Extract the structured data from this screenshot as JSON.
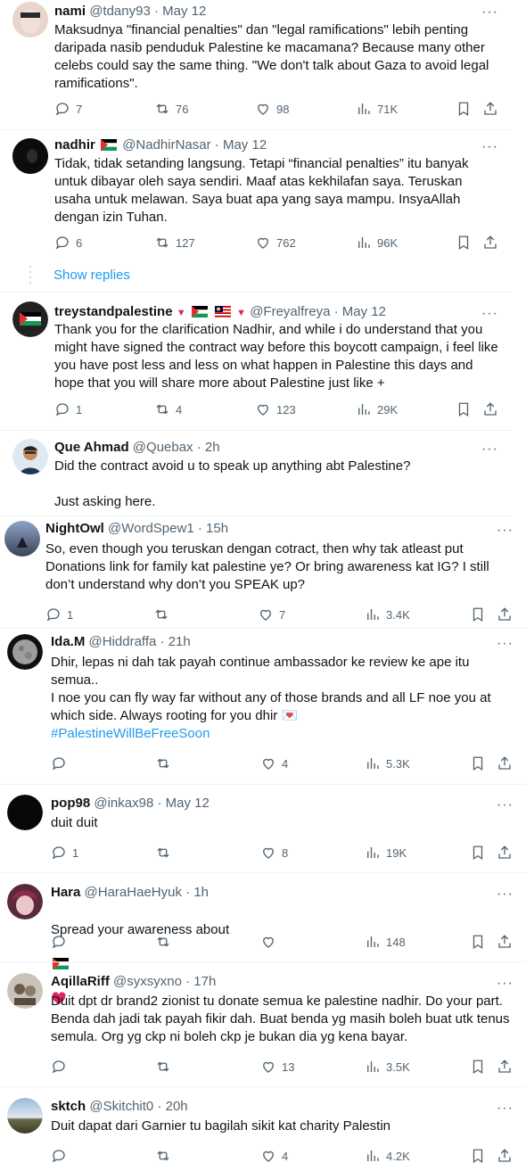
{
  "tweets": [
    {
      "name": "nami",
      "handle": "@tdany93",
      "date": "May 12",
      "text": "Maksudnya \"financial penalties\" dan \"legal ramifications\" lebih penting daripada nasib penduduk Palestine ke macamana? Because many other celebs could say the same thing. \"We don't talk about Gaza to avoid legal ramifications\".",
      "replies": "7",
      "reposts": "76",
      "likes": "98",
      "views": "71K"
    },
    {
      "name": "nadhir",
      "handle": "@NadhirNasar",
      "date": "May 12",
      "text": "Tidak, tidak setanding langsung. Tetapi “financial penalties” itu banyak untuk dibayar oleh saya sendiri. Maaf atas kekhilafan saya. Teruskan usaha untuk melawan. Saya buat apa yang saya mampu. InsyaAllah dengan izin Tuhan.",
      "replies": "6",
      "reposts": "127",
      "likes": "762",
      "views": "96K"
    },
    {
      "name": "treystandpalestine",
      "handle": "@Freyalfreya",
      "date": "May 12",
      "text": "Thank you for the clarification Nadhir, and while i do understand that you might have signed the contract way before this boycott campaign, i feel like you have post less and less on what happen in Palestine this days and hope that you will share more about Palestine just like +",
      "replies": "1",
      "reposts": "4",
      "likes": "123",
      "views": "29K"
    },
    {
      "name": "Que Ahmad",
      "handle": "@Quebax",
      "date": "2h",
      "text": "Did the contract avoid u to speak up anything abt Palestine?\n\nJust asking here."
    },
    {
      "name": "NightOwl",
      "handle": "@WordSpew1",
      "date": "15h",
      "text": "So, even though you teruskan dengan cotract, then why tak atleast put Donations link for family kat palestine ye? Or bring awareness kat IG? I still don’t understand why don’t you SPEAK up?",
      "replies": "1",
      "reposts": "",
      "likes": "7",
      "views": "3.4K"
    },
    {
      "name": "Ida.M",
      "handle": "@Hiddraffa",
      "date": "21h",
      "text": "Dhir, lepas ni dah tak payah continue ambassador ke review ke ape itu semua..\nI noe you can fly way far without any of those brands and all LF noe you at which side. Always rooting for you dhir 💌",
      "hashtag": "#PalestineWillBeFreeSoon",
      "replies": "",
      "reposts": "",
      "likes": "4",
      "views": "5.3K"
    },
    {
      "name": "pop98",
      "handle": "@inkax98",
      "date": "May 12",
      "text": "duit duit",
      "replies": "1",
      "reposts": "",
      "likes": "8",
      "views": "19K"
    },
    {
      "name": "Hara",
      "handle": "@HaraHaeHyuk",
      "date": "1h",
      "text": "Spread your awareness about",
      "replies": "",
      "reposts": "",
      "likes": "",
      "views": "148"
    },
    {
      "name": "AqillaRiff",
      "handle": "@syxsyxno",
      "date": "17h",
      "text": "Duit dpt dr brand2 zionist tu donate semua ke palestine nadhir. Do your part. Benda dah jadi tak payah fikir dah. Buat benda yg masih boleh buat utk tenus semula. Org yg ckp ni boleh ckp je bukan dia yg kena bayar.",
      "replies": "",
      "reposts": "",
      "likes": "13",
      "views": "3.5K"
    },
    {
      "name": "sktch",
      "handle": "@Skitchit0",
      "date": "20h",
      "text": "Duit dapat dari Garnier tu bagilah sikit kat charity Palestin",
      "replies": "",
      "reposts": "",
      "likes": "4",
      "views": "4.2K"
    }
  ],
  "show_replies": "Show replies",
  "more_label": "···",
  "colors": {
    "text": "#0f1419",
    "muted": "#536471",
    "link": "#1d9bf0",
    "border": "#eff3f4",
    "heart": "#f91880"
  }
}
